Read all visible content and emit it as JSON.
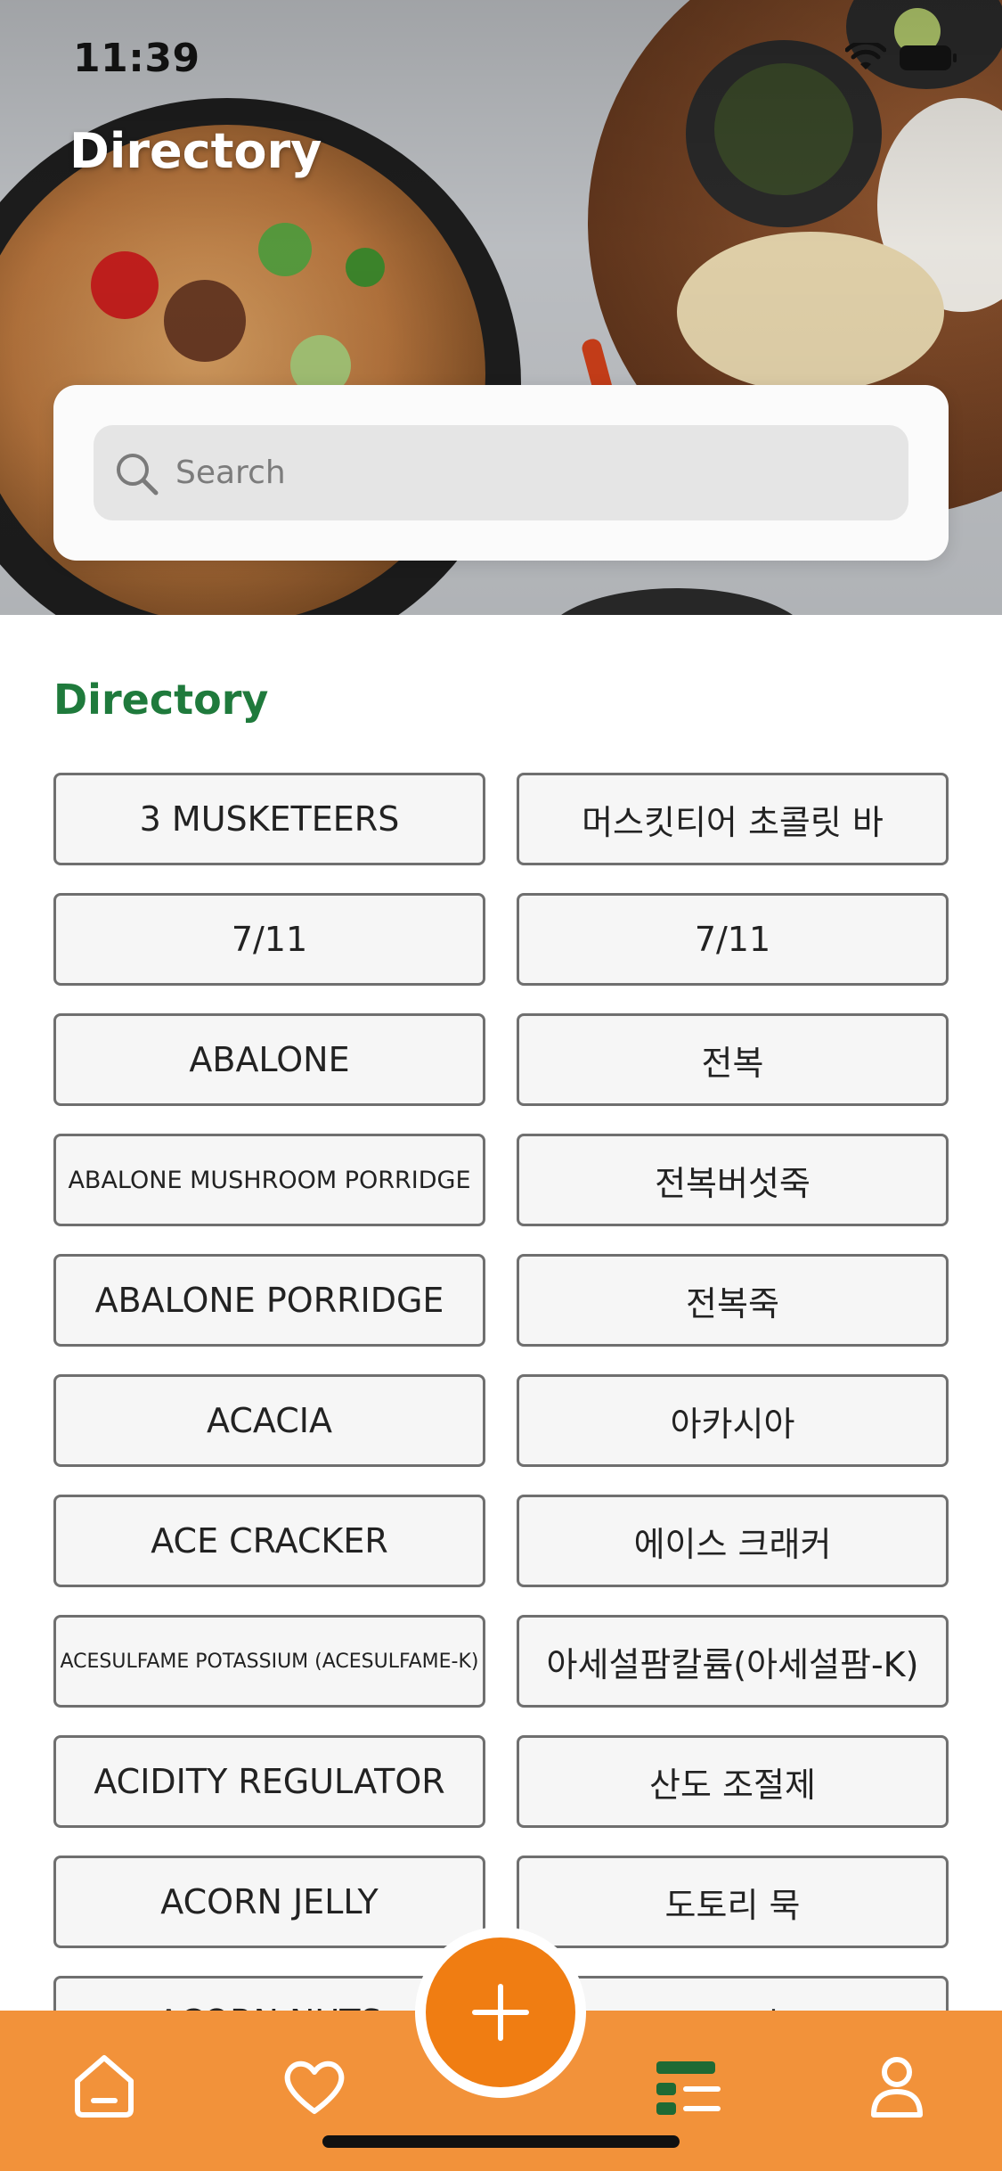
{
  "status_bar": {
    "time": "11:39"
  },
  "header": {
    "title": "Directory"
  },
  "search": {
    "placeholder": "Search"
  },
  "section": {
    "title": "Directory"
  },
  "entries": [
    {
      "en": "3 MUSKETEERS",
      "ko": "머스킷티어 초콜릿 바"
    },
    {
      "en": "7/11",
      "ko": "7/11"
    },
    {
      "en": "ABALONE",
      "ko": "전복"
    },
    {
      "en": "ABALONE MUSHROOM PORRIDGE",
      "ko": "전복버섯죽"
    },
    {
      "en": "ABALONE PORRIDGE",
      "ko": "전복죽"
    },
    {
      "en": "ACACIA",
      "ko": "아카시아"
    },
    {
      "en": "ACE CRACKER",
      "ko": "에이스 크래커"
    },
    {
      "en": "ACESULFAME POTASSIUM (ACESULFAME-K)",
      "ko": "아세설팜칼륨(아세설팜-K)"
    },
    {
      "en": "ACIDITY REGULATOR",
      "ko": "산도 조절제"
    },
    {
      "en": "ACORN JELLY",
      "ko": "도토리 묵"
    },
    {
      "en": "ACORN NUTS",
      "ko": "도토리"
    }
  ],
  "nav": {
    "items": [
      "home-icon",
      "heart-icon",
      "add-icon",
      "directory-icon",
      "profile-icon"
    ],
    "active": "directory-icon"
  },
  "colors": {
    "accent_green": "#1f7a3c",
    "nav_orange": "#f2923a",
    "fab_orange": "#f07d12",
    "active_icon_green": "#1f6a34"
  }
}
